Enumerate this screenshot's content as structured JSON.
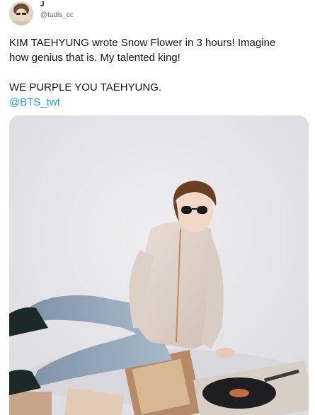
{
  "tweet": {
    "display_name": "J",
    "handle": "@tudis_cc",
    "text_lines": [
      "KIM TAEHYUNG wrote Snow Flower in 3 hours! Imagine",
      "how genius that is. My talented king!"
    ],
    "text_line_3": "WE PURPLE YOU TAEHYUNG.",
    "mention": "@BTS_twt",
    "avatar_icon": "profile-avatar-image",
    "media_description_icon": "photo-media",
    "colors": {
      "link": "#1d9bf0",
      "text": "#0f1419",
      "secondary": "#536471"
    }
  }
}
